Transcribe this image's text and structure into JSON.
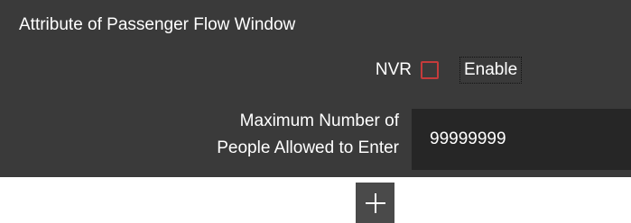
{
  "panel": {
    "title": "Attribute of Passenger Flow Window",
    "nvr": {
      "label": "NVR",
      "checked": false,
      "checkbox_color": "#c53b3b",
      "enable_label": "Enable"
    },
    "max_people": {
      "label_line1": "Maximum Number of",
      "label_line2": "People Allowed to Enter",
      "value": "99999999"
    }
  },
  "add_button": {
    "icon": "plus-icon"
  },
  "colors": {
    "panel_bg": "#3a3a3a",
    "input_bg": "#262626",
    "button_bg": "#4a4a4a",
    "text": "#ffffff"
  }
}
